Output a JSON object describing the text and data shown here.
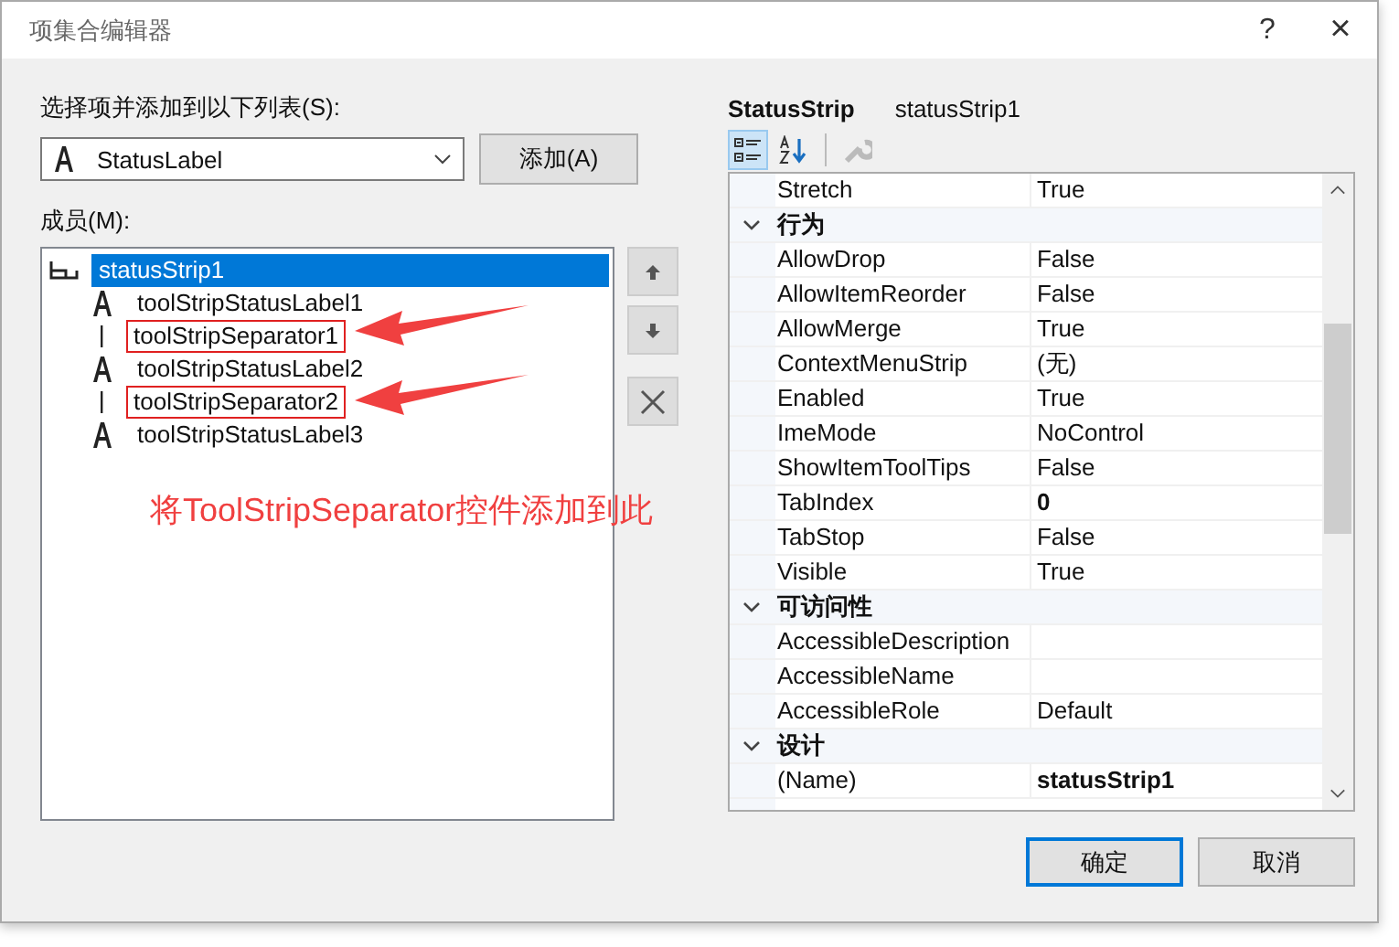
{
  "window": {
    "title": "项集合编辑器",
    "help": "?",
    "close": "×"
  },
  "add_section": {
    "label": "选择项并添加到以下列表(S):",
    "dropdown_value": "StatusLabel",
    "add_button": "添加(A)"
  },
  "members": {
    "label": "成员(M):",
    "items": [
      {
        "kind": "root",
        "text": "statusStrip1",
        "selected": true,
        "highlighted": false
      },
      {
        "kind": "label",
        "text": "toolStripStatusLabel1",
        "selected": false,
        "highlighted": false
      },
      {
        "kind": "separator",
        "text": "toolStripSeparator1",
        "selected": false,
        "highlighted": true
      },
      {
        "kind": "label",
        "text": "toolStripStatusLabel2",
        "selected": false,
        "highlighted": false
      },
      {
        "kind": "separator",
        "text": "toolStripSeparator2",
        "selected": false,
        "highlighted": true
      },
      {
        "kind": "label",
        "text": "toolStripStatusLabel3",
        "selected": false,
        "highlighted": false
      }
    ]
  },
  "annotation": "将ToolStripSeparator控件添加到此",
  "properties": {
    "type_name": "StatusStrip",
    "object_name": "statusStrip1",
    "categorized_selected": true,
    "rows": [
      {
        "kind": "property",
        "name": "Stretch",
        "value": "True",
        "bold": false
      },
      {
        "kind": "category",
        "name": "行为",
        "expanded": true
      },
      {
        "kind": "property",
        "name": "AllowDrop",
        "value": "False",
        "bold": false
      },
      {
        "kind": "property",
        "name": "AllowItemReorder",
        "value": "False",
        "bold": false
      },
      {
        "kind": "property",
        "name": "AllowMerge",
        "value": "True",
        "bold": false
      },
      {
        "kind": "property",
        "name": "ContextMenuStrip",
        "value": "(无)",
        "bold": false
      },
      {
        "kind": "property",
        "name": "Enabled",
        "value": "True",
        "bold": false
      },
      {
        "kind": "property",
        "name": "ImeMode",
        "value": "NoControl",
        "bold": false
      },
      {
        "kind": "property",
        "name": "ShowItemToolTips",
        "value": "False",
        "bold": false
      },
      {
        "kind": "property",
        "name": "TabIndex",
        "value": "0",
        "bold": true
      },
      {
        "kind": "property",
        "name": "TabStop",
        "value": "False",
        "bold": false
      },
      {
        "kind": "property",
        "name": "Visible",
        "value": "True",
        "bold": false
      },
      {
        "kind": "category",
        "name": "可访问性",
        "expanded": true
      },
      {
        "kind": "property",
        "name": "AccessibleDescription"
      },
      {
        "kind": "property",
        "name": "AccessibleName"
      },
      {
        "kind": "property",
        "name": "AccessibleRole",
        "value": "Default",
        "bold": false
      },
      {
        "kind": "category",
        "name": "设计",
        "expanded": true
      },
      {
        "kind": "property",
        "name": "(Name)",
        "value": "statusStrip1",
        "bold": true
      }
    ]
  },
  "buttons": [
    {
      "text": "确定",
      "default": true
    },
    {
      "text": "取消",
      "default": false
    }
  ]
}
